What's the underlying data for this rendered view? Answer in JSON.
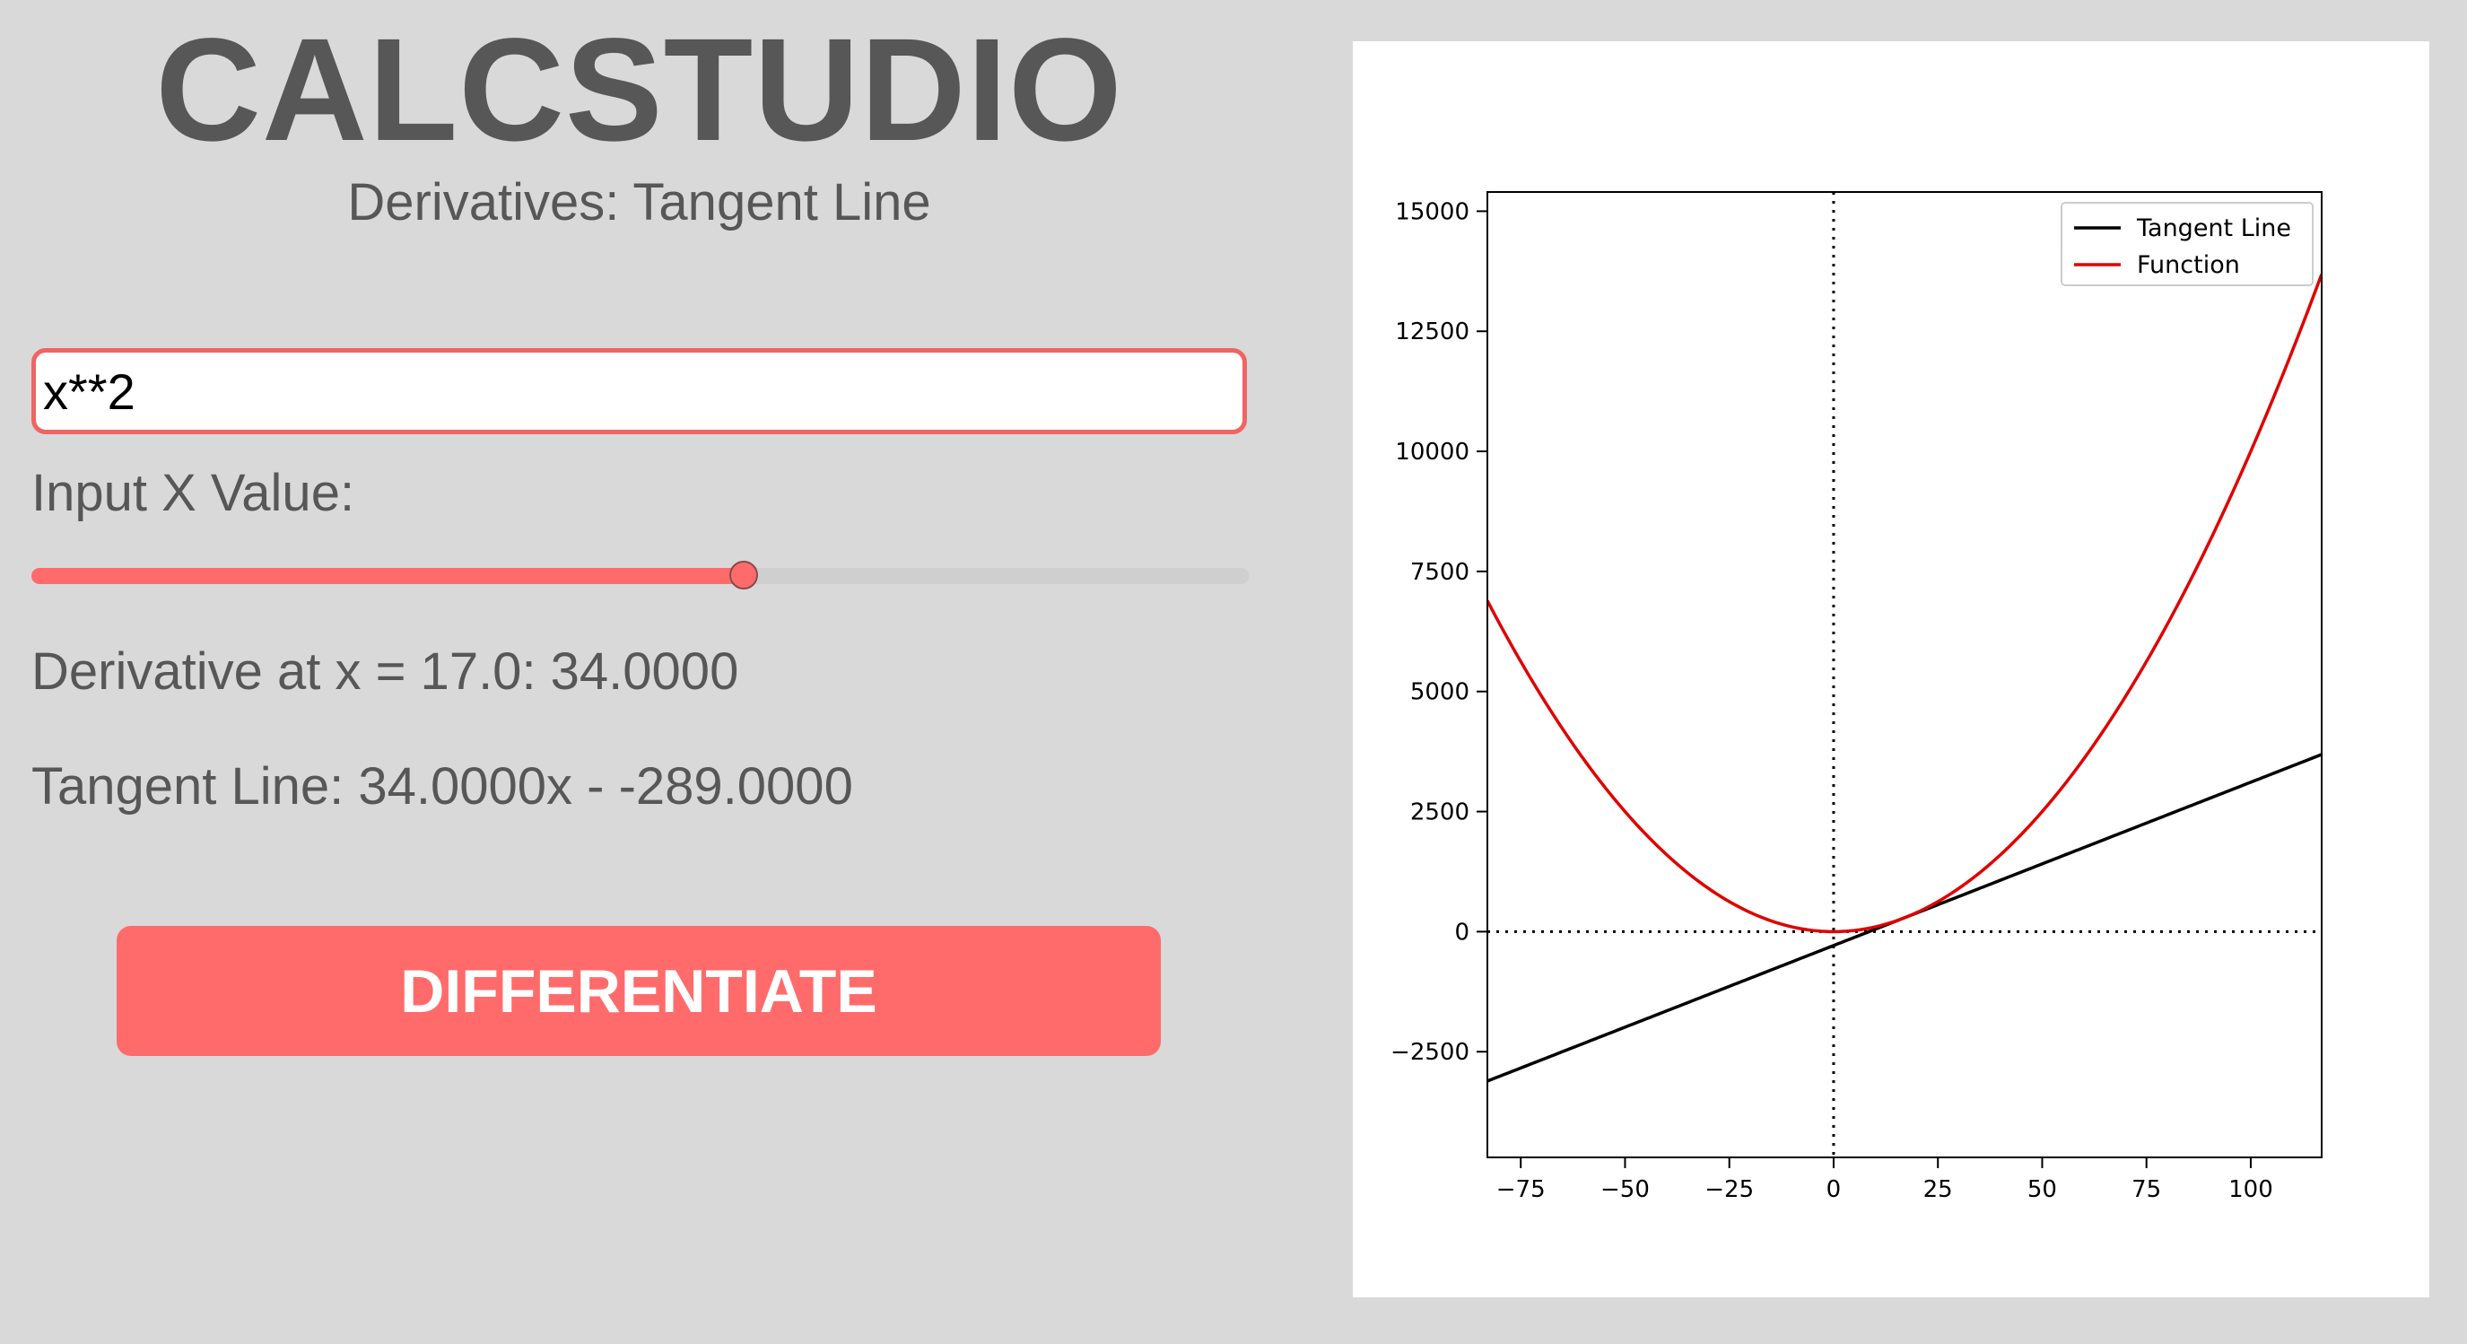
{
  "app": {
    "title": "CALCSTUDIO",
    "subtitle": "Derivatives: Tangent Line"
  },
  "function_input": {
    "value": "x**2"
  },
  "x_input": {
    "label": "Input X Value:",
    "slider": {
      "min": -100,
      "max": 100,
      "value": 17
    }
  },
  "results": {
    "derivative_text": "Derivative at x = 17.0: 34.0000",
    "tangent_text": "Tangent Line: 34.0000x - -289.0000"
  },
  "actions": {
    "differentiate_label": "DIFFERENTIATE"
  },
  "colors": {
    "accent": "#ff6b6b",
    "input_border": "#f06464",
    "text": "#575757",
    "background": "#d9d9d9",
    "function_line": "#e00000",
    "tangent_line": "#000000"
  },
  "chart_data": {
    "type": "line",
    "x_range": [
      -83,
      117
    ],
    "xlim": [
      -83,
      117
    ],
    "ylim": [
      -4700,
      15400
    ],
    "x_ticks": [
      -75,
      -50,
      -25,
      0,
      25,
      50,
      75,
      100
    ],
    "x_tick_labels": [
      "−75",
      "−50",
      "−25",
      "0",
      "25",
      "50",
      "75",
      "100"
    ],
    "y_ticks": [
      -2500,
      0,
      2500,
      5000,
      7500,
      10000,
      12500,
      15000
    ],
    "y_tick_labels": [
      "−2500",
      "0",
      "2500",
      "5000",
      "7500",
      "10000",
      "12500",
      "15000"
    ],
    "grid": false,
    "legend": "top-right",
    "reference_lines": {
      "x": 0,
      "y": 0,
      "style": "dotted"
    },
    "series": [
      {
        "name": "Tangent Line",
        "color": "#000000",
        "slope": 34,
        "intercept": -289
      },
      {
        "name": "Function",
        "color": "#e00000",
        "expression": "x**2"
      }
    ]
  }
}
